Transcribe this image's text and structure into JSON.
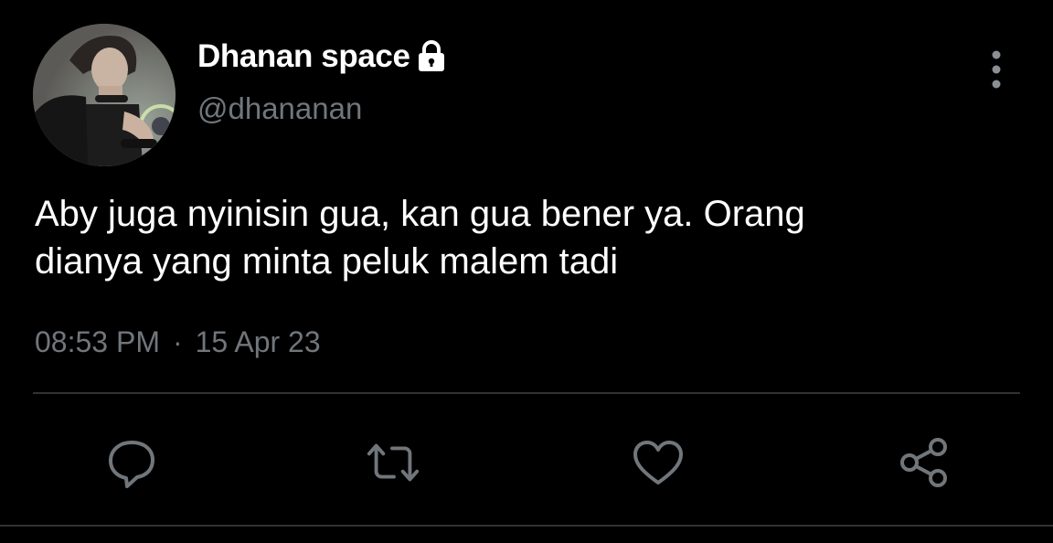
{
  "author": {
    "display_name": "Dhanan space",
    "handle": "@dhananan",
    "protected_icon": "lock-icon",
    "avatar": "profile-photo"
  },
  "tweet": {
    "text": "Aby juga nyinisin gua, kan gua bener ya. Orang\ndianya yang minta peluk malem tadi",
    "time": "08:53 PM",
    "separator": "·",
    "date": "15 Apr 23"
  },
  "actions": [
    {
      "name": "reply",
      "icon": "speech-bubble-icon"
    },
    {
      "name": "retweet",
      "icon": "retweet-arrows-icon"
    },
    {
      "name": "like",
      "icon": "heart-icon"
    },
    {
      "name": "share",
      "icon": "share-nodes-icon"
    }
  ],
  "menu": {
    "icon": "more-vertical-icon"
  },
  "colors": {
    "background": "#000000",
    "primary_text": "#ffffff",
    "secondary_text": "#71767b",
    "divider": "#2f3336"
  }
}
